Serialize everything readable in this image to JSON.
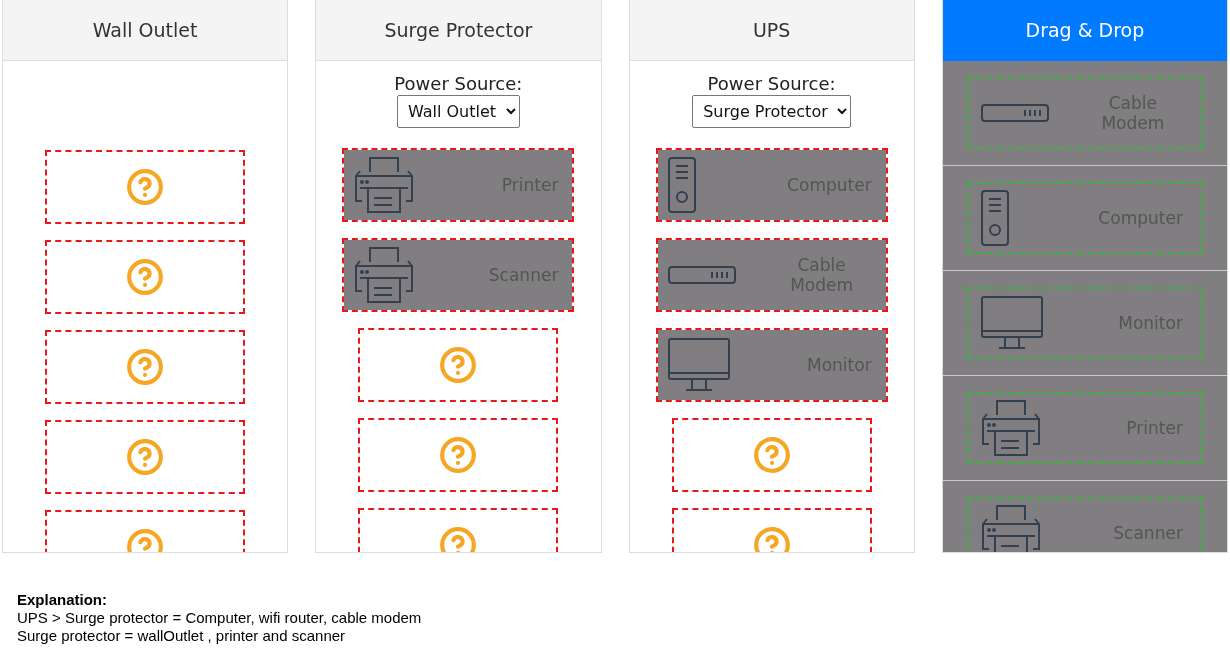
{
  "columns": [
    {
      "title": "Wall Outlet",
      "kind": "target",
      "slots": [
        {
          "kind": "empty"
        },
        {
          "kind": "empty"
        },
        {
          "kind": "empty"
        },
        {
          "kind": "empty"
        },
        {
          "kind": "empty"
        }
      ]
    },
    {
      "title": "Surge Protector",
      "kind": "target",
      "power_source": {
        "label": "Power Source:",
        "value": "Wall Outlet"
      },
      "slots": [
        {
          "kind": "printer",
          "name": "Printer"
        },
        {
          "kind": "printer",
          "name": "Scanner"
        },
        {
          "kind": "empty"
        },
        {
          "kind": "empty"
        },
        {
          "kind": "empty"
        }
      ]
    },
    {
      "title": "UPS",
      "kind": "target",
      "power_source": {
        "label": "Power Source:",
        "value": "Surge Protector"
      },
      "slots": [
        {
          "kind": "computer",
          "name": "Computer"
        },
        {
          "kind": "modem",
          "name": "Cable Modem"
        },
        {
          "kind": "monitor",
          "name": "Monitor"
        },
        {
          "kind": "empty"
        },
        {
          "kind": "empty"
        }
      ]
    },
    {
      "title": "Drag & Drop",
      "kind": "palette",
      "items": [
        {
          "kind": "modem",
          "name": "Cable Modem"
        },
        {
          "kind": "computer",
          "name": "Computer"
        },
        {
          "kind": "monitor",
          "name": "Monitor"
        },
        {
          "kind": "printer",
          "name": "Printer"
        },
        {
          "kind": "printer",
          "name": "Scanner"
        }
      ]
    }
  ],
  "explanation": {
    "heading": "Explanation:",
    "lines": [
      "UPS > Surge protector = Computer, wifi router, cable modem",
      "Surge protector = wallOutlet , printer and scanner"
    ]
  }
}
